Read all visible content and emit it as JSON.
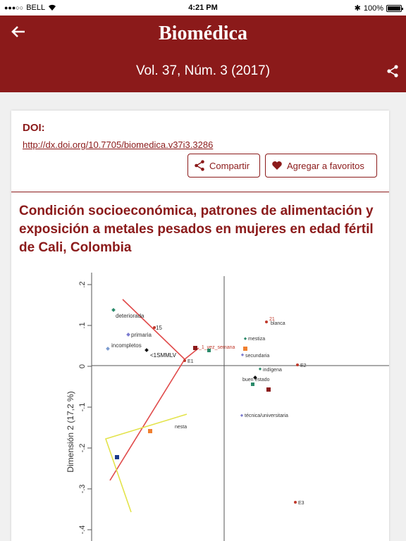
{
  "status": {
    "carrier": "BELL",
    "time": "4:21 PM",
    "battery": "100%"
  },
  "header": {
    "brand": "Biomédica",
    "issue": "Vol. 37, Núm. 3 (2017)"
  },
  "article": {
    "doi_label": "DOI:",
    "doi_url": "http://dx.doi.org/10.7705/biomedica.v37i3.3286",
    "share_label": "Compartir",
    "favorite_label": "Agregar a favoritos",
    "title": "Condición socioeconómica, patrones de alimentación y exposición a metales pesados en mujeres en edad fértil de Cali, Colombia"
  },
  "figure": {
    "ylabel": "Dimensión 2 (17,2 %)",
    "y_ticks": [
      ".2",
      ".1",
      "0",
      "-.1",
      "-.2",
      "-.3",
      "-.4"
    ],
    "points": [
      {
        "label": "deteriorada",
        "color": "#2a8a6a"
      },
      {
        "label": "15",
        "color": "#c0392b"
      },
      {
        "label": "primaria",
        "color": "#7b7bd0"
      },
      {
        "label": "incompletos",
        "color": "#7b9bd0"
      },
      {
        "label": "<1SMMLV",
        "color": "#111111"
      },
      {
        "label": "E1",
        "color": "#c0392b"
      },
      {
        "label": "_1_vez_semana",
        "color": "#8b1a1a"
      },
      {
        "label": "mestiza",
        "color": "#2a8a6a"
      },
      {
        "label": "blanca",
        "color": "#c0392b"
      },
      {
        "label": "21",
        "color": "#c0392b"
      },
      {
        "label": "E2",
        "color": "#c0392b"
      },
      {
        "label": "indígena",
        "color": "#2a8a6a"
      },
      {
        "label": "buen estado",
        "color": "#2a8a6a"
      },
      {
        "label": "secundaria",
        "color": "#7b7bd0"
      },
      {
        "label": "técnica/universitaria",
        "color": "#7b7bd0"
      },
      {
        "label": "nesta",
        "color": "#8b1a1a"
      },
      {
        "label": "E3",
        "color": "#c0392b"
      }
    ]
  }
}
